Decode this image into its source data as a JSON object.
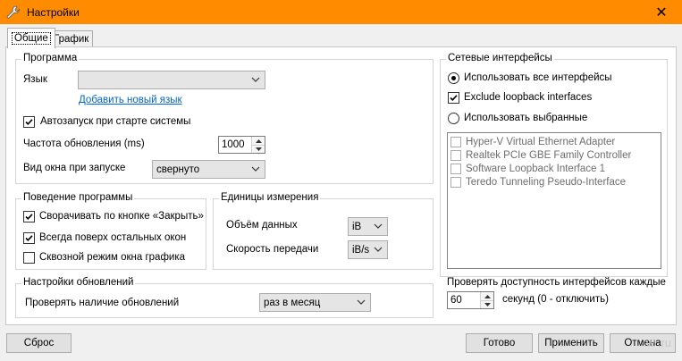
{
  "window": {
    "title": "Настройки",
    "close_glyph": "✕",
    "icon": "wrench-icon"
  },
  "tabs": [
    {
      "label": "Общие",
      "active": true
    },
    {
      "label": "График",
      "active": false
    }
  ],
  "program": {
    "title": "Программа",
    "language_label": "Язык",
    "language_value": "",
    "add_language_link": "Добавить новый язык",
    "autostart_label": "Автозапуск при старте системы",
    "autostart_checked": true,
    "update_freq_label": "Частота обновления (ms)",
    "update_freq_value": "1000",
    "window_view_label": "Вид окна при запуске",
    "window_view_value": "свернуто"
  },
  "behavior": {
    "title": "Поведение программы",
    "items": [
      {
        "label": "Сворачивать по кнопке «Закрыть»",
        "checked": true
      },
      {
        "label": "Всегда поверх остальных окон",
        "checked": true
      },
      {
        "label": "Сквозной режим окна графика",
        "checked": false
      }
    ]
  },
  "units": {
    "title": "Единицы измерения",
    "data_volume_label": "Объём данных",
    "data_volume_value": "iB",
    "speed_label": "Скорость передачи",
    "speed_value": "iB/s"
  },
  "updates": {
    "title": "Настройки обновлений",
    "check_label": "Проверять наличие обновлений",
    "check_value": "раз в месяц"
  },
  "network": {
    "title": "Сетевые интерфейсы",
    "use_all_label": "Использовать все интерфейсы",
    "use_all_selected": true,
    "exclude_loopback_label": "Exclude loopback interfaces",
    "exclude_loopback_checked": true,
    "use_selected_label": "Использовать выбранные",
    "use_selected_selected": false,
    "interfaces": [
      "Hyper-V Virtual Ethernet Adapter",
      "Realtek PCIe GBE Family Controller",
      "Software Loopback Interface 1",
      "Teredo Tunneling Pseudo-Interface"
    ],
    "check_availability_label": "Проверять доступность интерфейсов каждые",
    "seconds_value": "60",
    "seconds_suffix": "секунд (0 - отключить)"
  },
  "buttons": {
    "reset": "Сброс",
    "ok": "Готово",
    "apply": "Применить",
    "cancel": "Отмена"
  },
  "watermark": "w        .ru",
  "colors": {
    "titlebar": "#ff8c00",
    "link": "#0066cc"
  }
}
